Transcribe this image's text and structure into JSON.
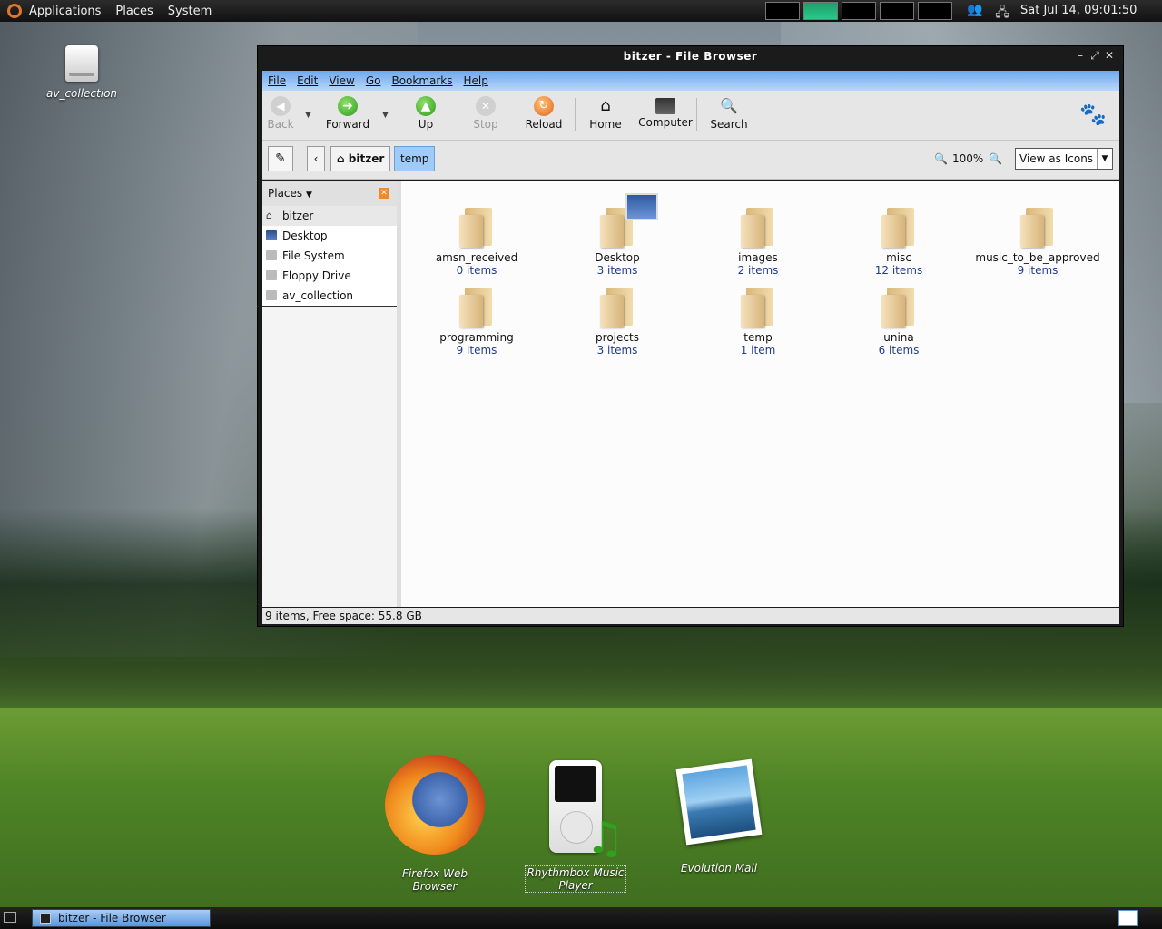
{
  "top_panel": {
    "menus": [
      "Applications",
      "Places",
      "System"
    ],
    "clock": "Sat Jul 14, 09:01:50"
  },
  "desktop": {
    "icons": [
      {
        "label": "av_collection"
      }
    ],
    "dock": [
      {
        "label": "Firefox Web Browser"
      },
      {
        "label": "Rhythmbox Music Player"
      },
      {
        "label": "Evolution Mail"
      }
    ]
  },
  "window": {
    "title": "bitzer - File Browser",
    "menubar": [
      "File",
      "Edit",
      "View",
      "Go",
      "Bookmarks",
      "Help"
    ],
    "toolbar": {
      "back": "Back",
      "forward": "Forward",
      "up": "Up",
      "stop": "Stop",
      "reload": "Reload",
      "home": "Home",
      "computer": "Computer",
      "search": "Search"
    },
    "location": {
      "crumbs": [
        "bitzer",
        "temp"
      ],
      "zoom": "100%",
      "view_as": "View as Icons"
    },
    "sidebar": {
      "header": "Places",
      "items": [
        "bitzer",
        "Desktop",
        "File System",
        "Floppy Drive",
        "av_collection"
      ]
    },
    "files": [
      {
        "name": "amsn_received",
        "count": "0 items"
      },
      {
        "name": "Desktop",
        "count": "3 items"
      },
      {
        "name": "images",
        "count": "2 items"
      },
      {
        "name": "misc",
        "count": "12 items"
      },
      {
        "name": "music_to_be_approved",
        "count": "9 items"
      },
      {
        "name": "programming",
        "count": "9 items"
      },
      {
        "name": "projects",
        "count": "3 items"
      },
      {
        "name": "temp",
        "count": "1 item"
      },
      {
        "name": "unina",
        "count": "6 items"
      }
    ],
    "status": "9 items, Free space: 55.8 GB"
  },
  "bottom_panel": {
    "task": "bitzer - File Browser"
  }
}
